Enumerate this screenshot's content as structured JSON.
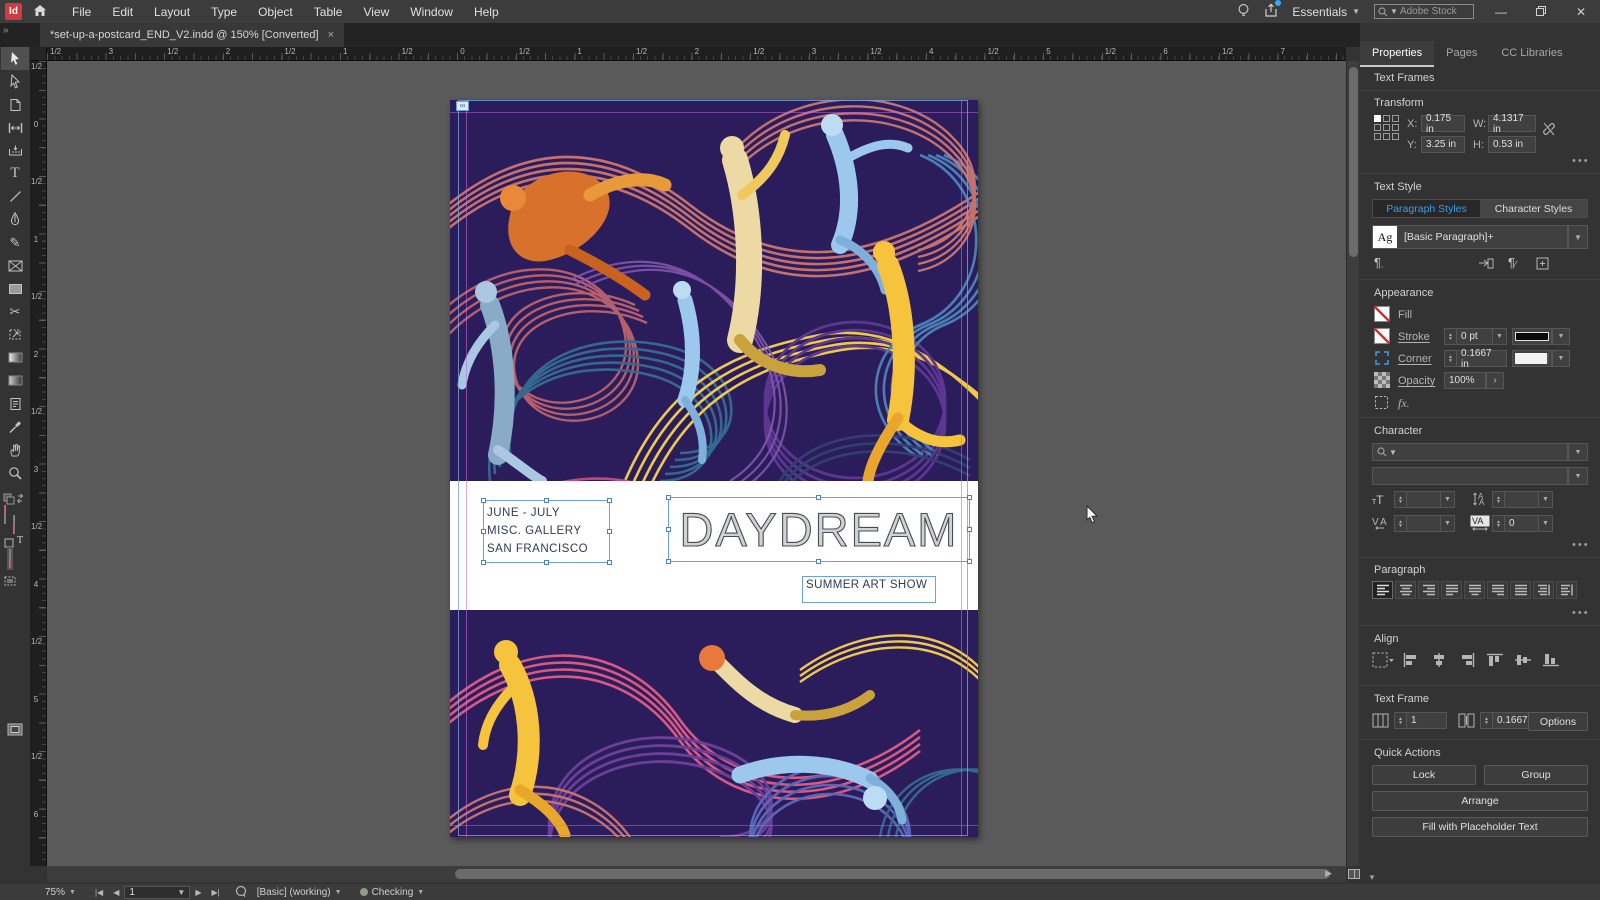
{
  "menubar": {
    "items": [
      "File",
      "Edit",
      "Layout",
      "Type",
      "Object",
      "Table",
      "View",
      "Window",
      "Help"
    ],
    "logo": "Id",
    "workspace": "Essentials",
    "search_placeholder": "Adobe Stock"
  },
  "doctab": {
    "title": "*set-up-a-postcard_END_V2.indd @ 150% [Converted]",
    "close": "×"
  },
  "rulers": {
    "horizontal": [
      "1/2",
      "3",
      "1/2",
      "2",
      "1/2",
      "1",
      "1/2",
      "0",
      "1/2",
      "1",
      "1/2",
      "2",
      "1/2",
      "3",
      "1/2",
      "4",
      "1/2",
      "5",
      "1/2",
      "6",
      "1/2",
      "7"
    ],
    "vertical": [
      "1/2",
      "0",
      "1/2",
      "1",
      "1/2",
      "2",
      "1/2",
      "3",
      "1/2",
      "4",
      "1/2",
      "5",
      "1/2",
      "6"
    ]
  },
  "toolbar_tools": [
    "selection-tool",
    "direct-selection-tool",
    "page-tool",
    "gap-tool",
    "content-collector-tool",
    "type-tool",
    "line-tool",
    "pen-tool",
    "pencil-tool",
    "rectangle-frame-tool",
    "rectangle-tool",
    "scissors-tool",
    "free-transform-tool",
    "gradient-swatch-tool",
    "gradient-feather-tool",
    "note-tool",
    "eyedropper-tool",
    "hand-tool",
    "zoom-tool"
  ],
  "postcard": {
    "line1": "JUNE - JULY",
    "line2": "MISC. GALLERY",
    "line3": "SAN FRANCISCO",
    "headline": "DAYDREAM",
    "subtitle": "SUMMER ART SHOW"
  },
  "panel": {
    "tabs": [
      "Properties",
      "Pages",
      "CC Libraries"
    ],
    "selection_label": "Text Frames",
    "transform": {
      "title": "Transform",
      "x_label": "X:",
      "x_value": "0.175 in",
      "y_label": "Y:",
      "y_value": "3.25 in",
      "w_label": "W:",
      "w_value": "4.1317 in",
      "h_label": "H:",
      "h_value": "0.53 in"
    },
    "text_style": {
      "title": "Text Style",
      "tab_paragraph": "Paragraph Styles",
      "tab_character": "Character Styles",
      "badge": "Ag",
      "style_name": "[Basic Paragraph]+"
    },
    "appearance": {
      "title": "Appearance",
      "fill_label": "Fill",
      "stroke_label": "Stroke",
      "stroke_weight": "0 pt",
      "corner_label": "Corner",
      "corner_value": "0.1667 in",
      "opacity_label": "Opacity",
      "opacity_value": "100%",
      "fx_label": "fx."
    },
    "character": {
      "title": "Character",
      "tracking_value": "0"
    },
    "paragraph": {
      "title": "Paragraph"
    },
    "align": {
      "title": "Align"
    },
    "text_frame": {
      "title": "Text Frame",
      "columns_value": "1",
      "inset_value": "0.1667",
      "options_label": "Options"
    },
    "quick_actions": {
      "title": "Quick Actions",
      "lock": "Lock",
      "group": "Group",
      "arrange": "Arrange",
      "fill_placeholder": "Fill with Placeholder Text"
    }
  },
  "statusbar": {
    "zoom": "75%",
    "page": "1",
    "preset": "[Basic] (working)",
    "preflight": "Checking"
  },
  "colors": {
    "accent_blue": "#3f9be0",
    "selection_blue": "#6f9fd8",
    "artwork_bg": "#2b1d5c",
    "logo_red": "#d23a3f"
  }
}
